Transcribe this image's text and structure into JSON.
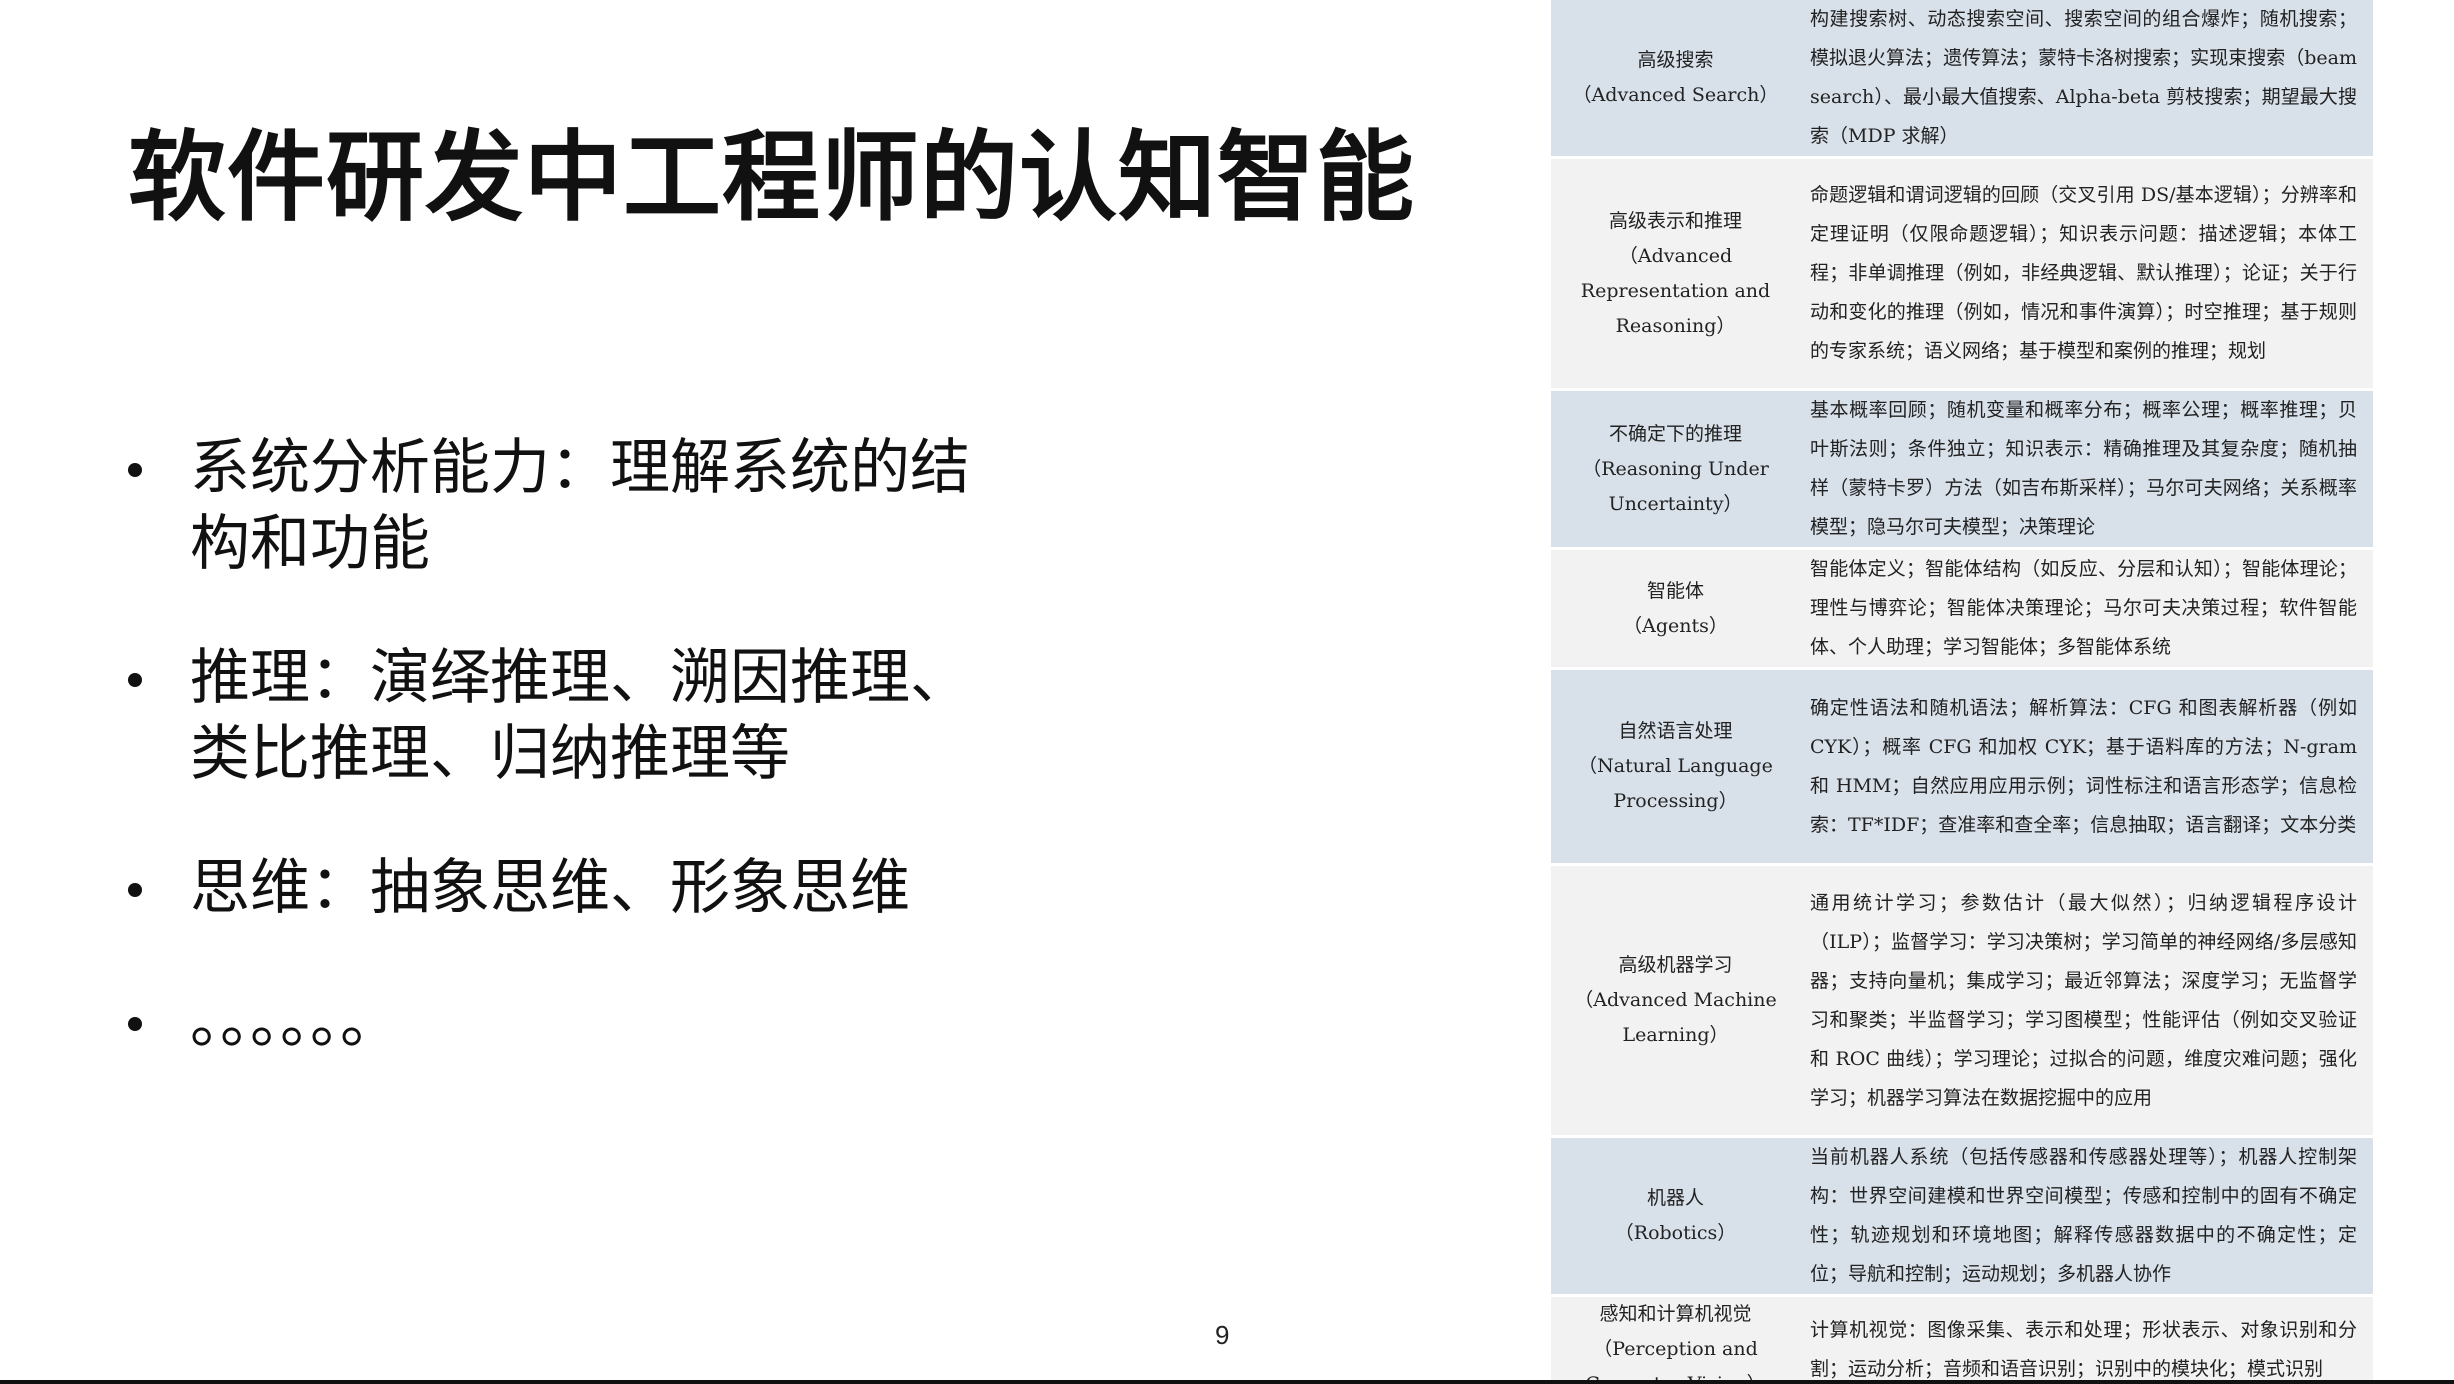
{
  "slide": {
    "title": "软件研发中工程师的认知智能",
    "page_number": "9",
    "bullets": [
      {
        "lines": [
          "系统分析能力：理解系统的结",
          "构和功能"
        ]
      },
      {
        "lines": [
          "推理：演绎推理、溯因推理、",
          "类比推理、归纳推理等"
        ]
      },
      {
        "lines": [
          "思维：抽象思维、形象思维"
        ]
      },
      {
        "lines": [
          "。。。。。。"
        ]
      }
    ]
  },
  "table": {
    "rows": [
      {
        "topic": [
          "高级搜索",
          "（Advanced Search）"
        ],
        "detail": "构建搜索树、动态搜索空间、搜索空间的组合爆炸；随机搜索；模拟退火算法；遗传算法；蒙特卡洛树搜索；实现束搜索（beam search）、最小最大值搜索、Alpha-beta 剪枝搜索；期望最大搜索（MDP 求解）"
      },
      {
        "topic": [
          "高级表示和推理",
          "（Advanced",
          "Representation and",
          "Reasoning）"
        ],
        "detail": "命题逻辑和谓词逻辑的回顾（交叉引用 DS/基本逻辑）；分辨率和定理证明（仅限命题逻辑）；知识表示问题：描述逻辑；本体工程；非单调推理（例如，非经典逻辑、默认推理）；论证；关于行动和变化的推理（例如，情况和事件演算）；时空推理；基于规则的专家系统；语义网络；基于模型和案例的推理；规划"
      },
      {
        "topic": [
          "不确定下的推理",
          "（Reasoning Under",
          "Uncertainty）"
        ],
        "detail": "基本概率回顾；随机变量和概率分布；概率公理；概率推理；贝叶斯法则；条件独立；知识表示：精确推理及其复杂度；随机抽样（蒙特卡罗）方法（如吉布斯采样）；马尔可夫网络；关系概率模型；隐马尔可夫模型；决策理论"
      },
      {
        "topic": [
          "智能体",
          "（Agents）"
        ],
        "detail": "智能体定义；智能体结构（如反应、分层和认知）；智能体理论；理性与博弈论；智能体决策理论；马尔可夫决策过程；软件智能体、个人助理；学习智能体；多智能体系统"
      },
      {
        "topic": [
          "自然语言处理",
          "（Natural Language",
          "Processing）"
        ],
        "detail": "确定性语法和随机语法；解析算法：CFG 和图表解析器（例如 CYK）；概率 CFG 和加权 CYK；基于语料库的方法；N-gram 和 HMM；自然应用应用示例；词性标注和语言形态学；信息检索：TF*IDF；查准率和查全率；信息抽取；语言翻译；文本分类"
      },
      {
        "topic": [
          "高级机器学习",
          "（Advanced Machine",
          "Learning）"
        ],
        "detail": "通用统计学习；参数估计（最大似然）；归纳逻辑程序设计（ILP）；监督学习：学习决策树；学习简单的神经网络/多层感知器；支持向量机；集成学习；最近邻算法；深度学习；无监督学习和聚类；半监督学习；学习图模型；性能评估（例如交叉验证和 ROC 曲线）；学习理论；过拟合的问题，维度灾难问题；强化学习；机器学习算法在数据挖掘中的应用"
      },
      {
        "topic": [
          "机器人",
          "（Robotics）"
        ],
        "detail": "当前机器人系统（包括传感器和传感器处理等）；机器人控制架构：世界空间建模和世界空间模型；传感和控制中的固有不确定性；轨迹规划和环境地图；解释传感器数据中的不确定性；定位；导航和控制；运动规划；多机器人协作"
      },
      {
        "topic": [
          "感知和计算机视觉",
          "（Perception and",
          "Computer Vision）"
        ],
        "detail": "计算机视觉：图像采集、表示和处理；形状表示、对象识别和分割；运动分析；音频和语音识别；识别中的模块化；模式识别"
      }
    ]
  }
}
